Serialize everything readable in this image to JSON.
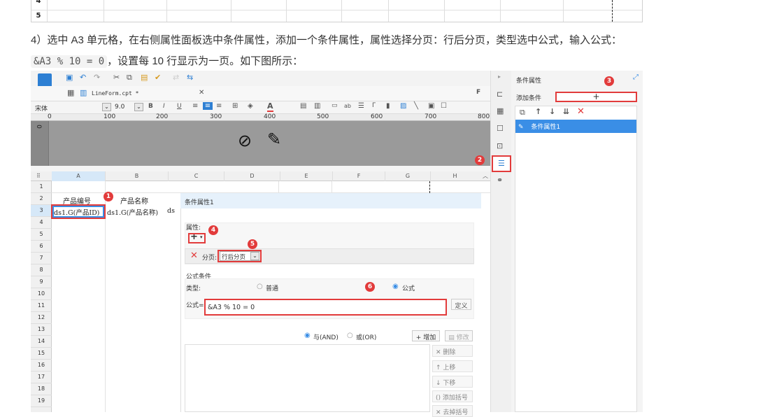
{
  "top_grid": {
    "rows": [
      "4",
      "5"
    ]
  },
  "instruction": {
    "line1": "4）选中  A3 单元格，在右侧属性面板选中条件属性，添加一个条件属性，属性选择分页：行后分页，类型选中公式，输入公式：",
    "code": "&A3 % 10 = 0",
    "line2_suffix": "，设置每 10 行显示为一页。如下图所示："
  },
  "editor": {
    "tab_name": "LineForm.cpt *",
    "font_name": "宋体",
    "font_size": "9.0",
    "ruler_ticks": [
      "0",
      "100",
      "200",
      "300",
      "400",
      "500",
      "600",
      "700",
      "800"
    ],
    "columns": [
      "A",
      "B",
      "C",
      "D",
      "E",
      "F",
      "G",
      "H"
    ],
    "rows": [
      "1",
      "2",
      "3",
      "4",
      "5",
      "6",
      "7",
      "8",
      "9",
      "10",
      "11",
      "12",
      "13",
      "14",
      "15",
      "16",
      "17",
      "18",
      "19"
    ],
    "cells": {
      "a2": "产品编号",
      "b2": "产品名称",
      "a3": "ds1.G(产品ID)",
      "b3": "ds1.G(产品名称)",
      "c3": "ds"
    }
  },
  "cond_panel": {
    "title": "条件属性1",
    "attr_label": "属性:",
    "page_label": "分页:",
    "page_value": "行后分页",
    "formula_section": "公式条件",
    "type_label": "类型:",
    "type_normal": "普通",
    "type_formula": "公式",
    "formula_label": "公式=",
    "formula_value": "&A3 % 10 = 0",
    "define_button": "定义",
    "and_label": "与(AND)",
    "or_label": "或(OR)",
    "add_button": "增加",
    "modify_button": "修改",
    "delete_button": "删除",
    "up_button": "上移",
    "down_button": "下移",
    "bracket_button": "添加括号",
    "remove_bracket_button": "去掉括号"
  },
  "right_panel": {
    "title": "条件属性",
    "add_label": "添加条件",
    "add_symbol": "+",
    "item": "条件属性1"
  },
  "badges": [
    "1",
    "2",
    "3",
    "4",
    "5",
    "6"
  ],
  "colors": {
    "accent": "#3a8ee6",
    "highlight_red": "#e23b3b",
    "selected_row": "#3a8ee6"
  }
}
